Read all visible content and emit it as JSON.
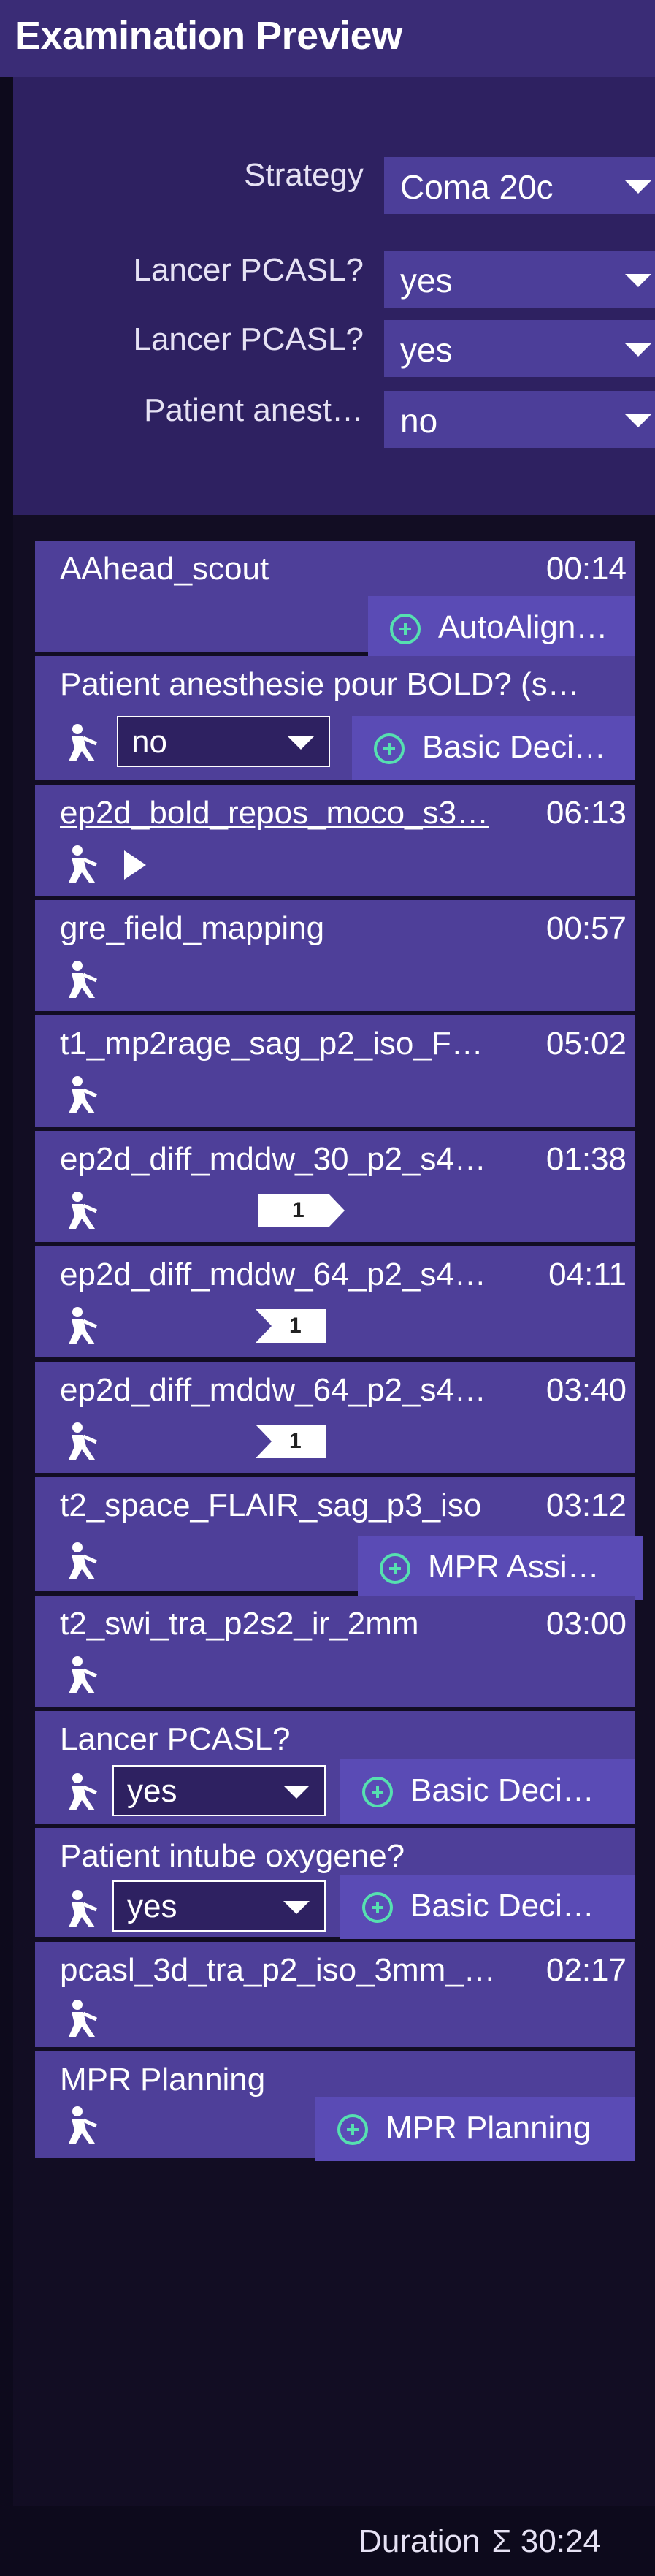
{
  "header": {
    "title": "Examination Preview"
  },
  "settings": [
    {
      "label": "Strategy",
      "value": "Coma 20c"
    },
    {
      "label": "Lancer PCASL?",
      "value": "yes"
    },
    {
      "label": "Lancer PCASL?",
      "value": "yes"
    },
    {
      "label": "Patient anest…",
      "value": "no"
    }
  ],
  "rows": [
    {
      "name": "AAhead_scout",
      "time": "00:14",
      "button": "AutoAlign…"
    },
    {
      "name": "Patient anesthesie pour BOLD? (s…",
      "select": "no",
      "button": "Basic Deci…"
    },
    {
      "name": "ep2d_bold_repos_moco_s3…",
      "time": "06:13"
    },
    {
      "name": "gre_field_mapping",
      "time": "00:57"
    },
    {
      "name": "t1_mp2rage_sag_p2_iso_F…",
      "time": "05:02"
    },
    {
      "name": "ep2d_diff_mddw_30_p2_s4…",
      "time": "01:38",
      "flag": "1"
    },
    {
      "name": "ep2d_diff_mddw_64_p2_s4…",
      "time": "04:11",
      "flag": "1"
    },
    {
      "name": "ep2d_diff_mddw_64_p2_s4…",
      "time": "03:40",
      "flag": "1"
    },
    {
      "name": "t2_space_FLAIR_sag_p3_iso",
      "time": "03:12",
      "button": "MPR Assi…"
    },
    {
      "name": "t2_swi_tra_p2s2_ir_2mm",
      "time": "03:00"
    },
    {
      "name": "Lancer PCASL?",
      "select": "yes",
      "button": "Basic Deci…"
    },
    {
      "name": "Patient intube oxygene?",
      "select": "yes",
      "button": "Basic Deci…"
    },
    {
      "name": "pcasl_3d_tra_p2_iso_3mm_…",
      "time": "02:17"
    },
    {
      "name": "MPR Planning",
      "button": "MPR Planning"
    }
  ],
  "footer": {
    "duration_label": "Duration",
    "total": "Σ 30:24"
  },
  "colors": {
    "accent": "#56e0b0",
    "row": "#4e3f99",
    "header": "#3a2c76"
  }
}
